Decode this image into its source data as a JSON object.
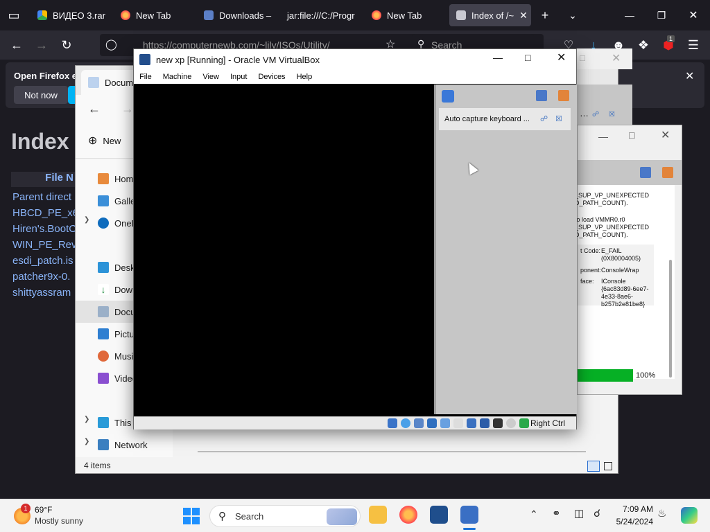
{
  "browser": {
    "tabs": [
      {
        "label": "ВИДЕО 3.rar",
        "icon": "google-drive-icon"
      },
      {
        "label": "New Tab",
        "icon": "firefox-icon"
      },
      {
        "label": "Downloads –",
        "icon": "virtualbox-icon"
      },
      {
        "label": "jar:file:///C:/Progr",
        "icon": "file-icon"
      },
      {
        "label": "New Tab",
        "icon": "firefox-icon"
      },
      {
        "label": "Index of /~",
        "icon": "page-icon"
      }
    ],
    "url": "https://computernewb.com/~lily/ISOs/Utility/",
    "search_placeholder": "Search",
    "badge_count": "1",
    "infobar_text": "Open Firefox ev",
    "not_now_label": "Not now"
  },
  "page": {
    "title": "Index",
    "column_header": "File N",
    "links": [
      "Parent direct",
      "HBCD_PE_x6",
      "Hiren's.BootC",
      "WIN_PE_Rev",
      "esdi_patch.is",
      "patcher9x-0.",
      "shittyassram"
    ]
  },
  "explorer": {
    "tab_title": "Docum",
    "new_label": "New",
    "nav_items": [
      {
        "label": "Hom",
        "icon": "home-icon"
      },
      {
        "label": "Galler",
        "icon": "gallery-icon"
      },
      {
        "label": "OneD",
        "icon": "onedrive-icon"
      },
      {
        "label": "Deskt",
        "icon": "desktop-icon"
      },
      {
        "label": "Down",
        "icon": "download-icon"
      },
      {
        "label": "Docu",
        "icon": "documents-icon"
      },
      {
        "label": "Pictur",
        "icon": "pictures-icon"
      },
      {
        "label": "Musi",
        "icon": "music-icon"
      },
      {
        "label": "Video",
        "icon": "videos-icon"
      },
      {
        "label": "This P",
        "icon": "this-pc-icon"
      },
      {
        "label": "Network",
        "icon": "network-icon"
      }
    ],
    "status": "4 items"
  },
  "vbox": {
    "title": "new xp [Running] - Oracle VM VirtualBox",
    "menu": [
      "File",
      "Machine",
      "View",
      "Input",
      "Devices",
      "Help"
    ],
    "notification": "Auto capture keyboard ...",
    "host_key": "Right Ctrl"
  },
  "error_dialog": {
    "lines": [
      "_SUP_VP_UNEXPECTED",
      "D_PATH_COUNT).",
      "to load VMMR0.r0",
      "_SUP_VP_UNEXPECTED",
      "D_PATH_COUNT)."
    ],
    "details": [
      {
        "key": "t Code:",
        "value": "E_FAIL (0X80004005)"
      },
      {
        "key": "ponent:",
        "value": "ConsoleWrap"
      },
      {
        "key": "face:",
        "value": "IConsole {6ac83d89-6ee7-4e33-8ae6-b257b2e81be8}"
      }
    ],
    "progress_label": "100%",
    "progress_value": 1.0,
    "partial_text": "…"
  },
  "taskbar": {
    "weather_temp": "69°F",
    "weather_desc": "Mostly sunny",
    "weather_badge": "1",
    "search_label": "Search",
    "time": "7:09 AM",
    "date": "5/24/2024"
  },
  "colors": {
    "accent_green": "#06b025",
    "firefox_bg": "#1c1b22",
    "link_blue": "#8ab4f8"
  }
}
